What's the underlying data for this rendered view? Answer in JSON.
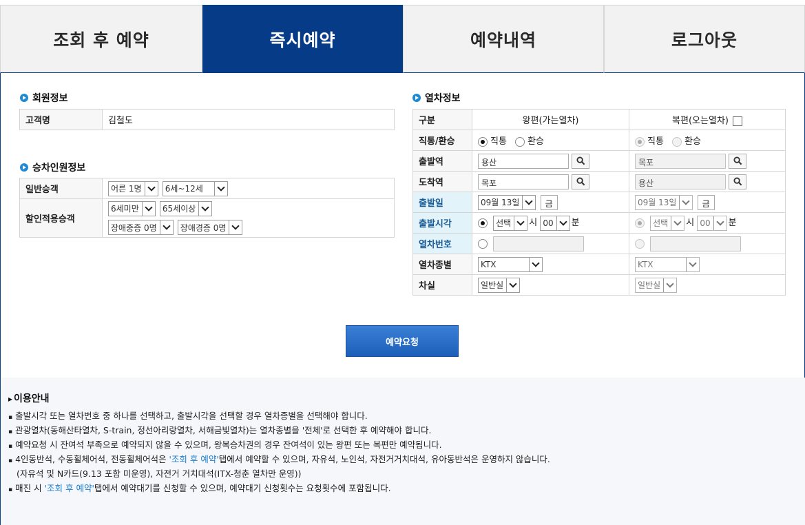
{
  "tabs": [
    {
      "label": "조회 후 예약"
    },
    {
      "label": "즉시예약"
    },
    {
      "label": "예약내역"
    },
    {
      "label": "로그아웃"
    }
  ],
  "member": {
    "title": "회원정보",
    "name_label": "고객명",
    "name_value": "김철도"
  },
  "passenger": {
    "title": "승차인원정보",
    "general_label": "일반승객",
    "adult": "어른 1명",
    "child": "6세~12세",
    "discount_label": "할인적용승객",
    "under6": "6세미만",
    "senior": "65세이상",
    "severe": "장애중증 0명",
    "mild": "장애경증 0명"
  },
  "train": {
    "title": "열차정보",
    "col_type": "구분",
    "col_out": "왕편(가는열차)",
    "col_ret": "복편(오는열차)",
    "direct_label": "직통/환승",
    "direct": "직통",
    "transfer": "환승",
    "dep_label": "출발역",
    "arr_label": "도착역",
    "dep_out": "용산",
    "dep_ret": "목포",
    "arr_out": "목포",
    "arr_ret": "용산",
    "date_label": "출발일",
    "date_out": "09월 13일",
    "date_ret": "09월 13일",
    "weekday": "금",
    "time_label": "출발시각",
    "time_select": "선택",
    "hour_unit": "시",
    "minute": "00",
    "minute_unit": "분",
    "trainno_label": "열차번호",
    "kind_label": "열차종별",
    "kind": "KTX",
    "car_label": "차실",
    "car": "일반실"
  },
  "request_button": "예약요청",
  "notice": {
    "title": "이용안내",
    "l1": "출발시각 또는 열차번호 중 하나를 선택하고, 출발시각을 선택할 경우 열차종별을 선택해야 합니다.",
    "l2": "관광열차(동해산타열차, S-train, 정선아리랑열차, 서해금빛열차)는 열차종별을 '전체'로 선택한 후 예약해야 합니다.",
    "l3": "예약요청 시 잔여석 부족으로 예약되지 않을 수 있으며, 왕복승차권의 경우 잔여석이 있는 왕편 또는 복편만 예약됩니다.",
    "l4a": "4인동반석, 수동휠체어석, 전동휠체어석은 ",
    "l4link": "'조회 후 예약'",
    "l4b": "탭에서 예약할 수 있으며, 자유석, 노인석, 자전거거치대석, 유아동반석은 운영하지 않습니다.",
    "l5": "(자유석 및 N카드(9.13 포함 미운영), 자전거 거치대석(ITX-청춘 열차만 운영))",
    "l6a": "매진 시 ",
    "l6link": "'조회 후 예약'",
    "l6b": "탭에서 예약대기를 신청할 수 있으며, 예약대기 신청횟수는 요청횟수에 포함됩니다."
  }
}
